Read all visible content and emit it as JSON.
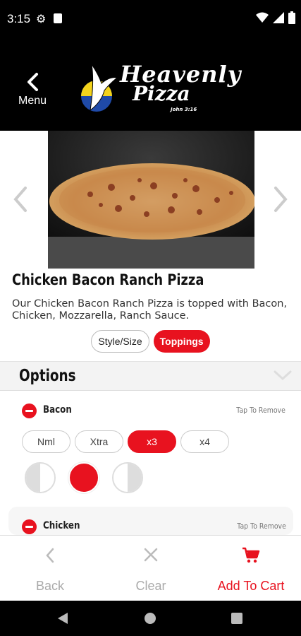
{
  "status_bar": {
    "time": "3:15"
  },
  "header": {
    "back_label": "Menu",
    "logo_line1": "Heavenly",
    "logo_line2": "Pizza",
    "logo_verse": "John 3:16"
  },
  "item": {
    "title": "Chicken Bacon Ranch Pizza",
    "description": "Our Chicken Bacon Ranch Pizza is topped with Bacon, Chicken, Mozzarella, Ranch Sauce."
  },
  "tabs": [
    {
      "label": "Style/Size",
      "active": false
    },
    {
      "label": "Toppings",
      "active": true
    }
  ],
  "options": {
    "title": "Options",
    "toppings": [
      {
        "name": "Bacon",
        "action_hint": "Tap To Remove",
        "amounts": [
          "Nml",
          "Xtra",
          "x3",
          "x4"
        ],
        "selected_amount": "x3",
        "placement": "whole"
      },
      {
        "name": "Chicken",
        "action_hint": "Tap To Remove"
      }
    ]
  },
  "bottom_actions": {
    "back": "Back",
    "clear": "Clear",
    "add_to_cart": "Add To Cart"
  },
  "colors": {
    "accent": "#e8121f",
    "header_bg": "#000000"
  }
}
